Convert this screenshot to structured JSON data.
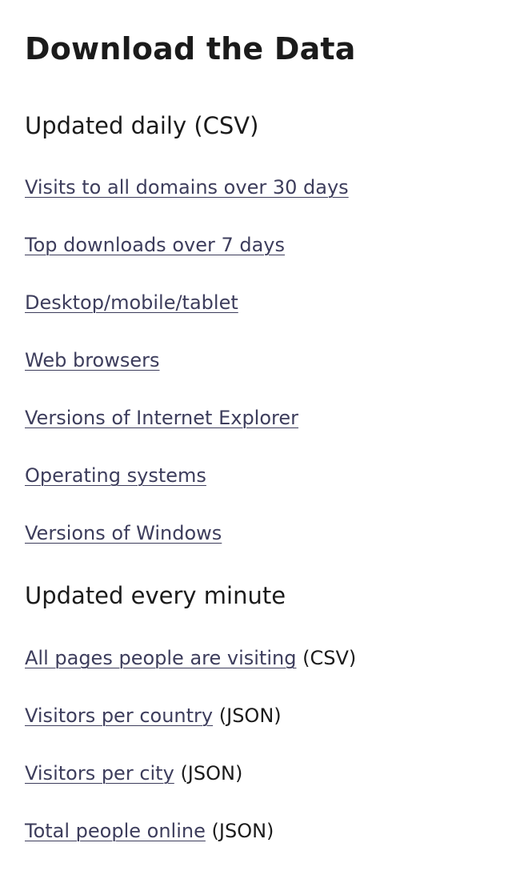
{
  "page_title": "Download the Data",
  "daily": {
    "heading": "Updated daily (CSV)",
    "links": [
      "Visits to all domains over 30 days",
      "Top downloads over 7 days",
      "Desktop/mobile/tablet",
      "Web browsers",
      "Versions of Internet Explorer",
      "Operating systems",
      "Versions of Windows"
    ]
  },
  "minute": {
    "heading": "Updated every minute",
    "links": [
      {
        "label": "All pages people are visiting",
        "format": "(CSV)"
      },
      {
        "label": "Visitors per country",
        "format": "(JSON)"
      },
      {
        "label": "Visitors per city",
        "format": "(JSON)"
      },
      {
        "label": "Total people online",
        "format": "(JSON)"
      }
    ]
  },
  "colors": {
    "link": "#3d3d5c",
    "text": "#1b1b1b",
    "background": "#ffffff"
  }
}
